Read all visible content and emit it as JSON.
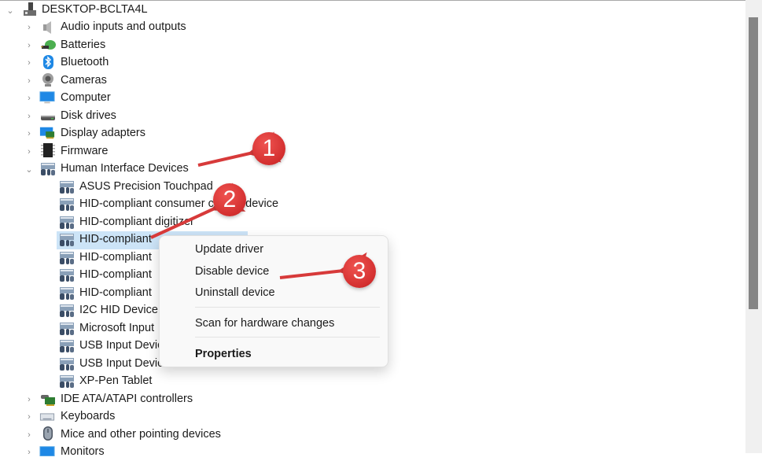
{
  "tree": {
    "root": {
      "label": "DESKTOP-BCLTA4L",
      "icon": "computer-tower-icon",
      "expanded": true
    },
    "categories": [
      {
        "label": "Audio inputs and outputs",
        "icon": "speaker-icon",
        "expanded": false
      },
      {
        "label": "Batteries",
        "icon": "battery-plug-icon",
        "expanded": false
      },
      {
        "label": "Bluetooth",
        "icon": "bluetooth-icon",
        "expanded": false
      },
      {
        "label": "Cameras",
        "icon": "webcam-icon",
        "expanded": false
      },
      {
        "label": "Computer",
        "icon": "monitor-icon",
        "expanded": false
      },
      {
        "label": "Disk drives",
        "icon": "disk-drive-icon",
        "expanded": false
      },
      {
        "label": "Display adapters",
        "icon": "display-adapter-icon",
        "expanded": false
      },
      {
        "label": "Firmware",
        "icon": "chip-icon",
        "expanded": false
      },
      {
        "label": "Human Interface Devices",
        "icon": "hid-icon",
        "expanded": true
      },
      {
        "label": "IDE ATA/ATAPI controllers",
        "icon": "ide-controller-icon",
        "expanded": false
      },
      {
        "label": "Keyboards",
        "icon": "keyboard-icon",
        "expanded": false
      },
      {
        "label": "Mice and other pointing devices",
        "icon": "mouse-icon",
        "expanded": false
      },
      {
        "label": "Monitors",
        "icon": "monitor-icon",
        "expanded": false
      }
    ],
    "hid_children": [
      {
        "label": "ASUS Precision Touchpad"
      },
      {
        "label": "HID-compliant consumer control device"
      },
      {
        "label": "HID-compliant digitizer"
      },
      {
        "label": "HID-compliant",
        "selected": true
      },
      {
        "label": "HID-compliant"
      },
      {
        "label": "HID-compliant"
      },
      {
        "label": "HID-compliant"
      },
      {
        "label": "I2C HID Device"
      },
      {
        "label": "Microsoft Input"
      },
      {
        "label": "USB Input Device"
      },
      {
        "label": "USB Input Device"
      },
      {
        "label": "XP-Pen Tablet"
      }
    ]
  },
  "context_menu": {
    "items": [
      {
        "label": "Update driver"
      },
      {
        "label": "Disable device"
      },
      {
        "label": "Uninstall device"
      },
      {
        "label": "Scan for hardware changes"
      },
      {
        "label": "Properties",
        "bold": true
      }
    ]
  },
  "annotations": [
    {
      "number": "1",
      "target": "Human Interface Devices"
    },
    {
      "number": "2",
      "target": "HID-compliant (selected)"
    },
    {
      "number": "3",
      "target": "Disable device"
    }
  ],
  "colors": {
    "selection": "#cce4f7",
    "annotation_red": "#d32f2f",
    "menu_bg": "#f9f9f9"
  }
}
